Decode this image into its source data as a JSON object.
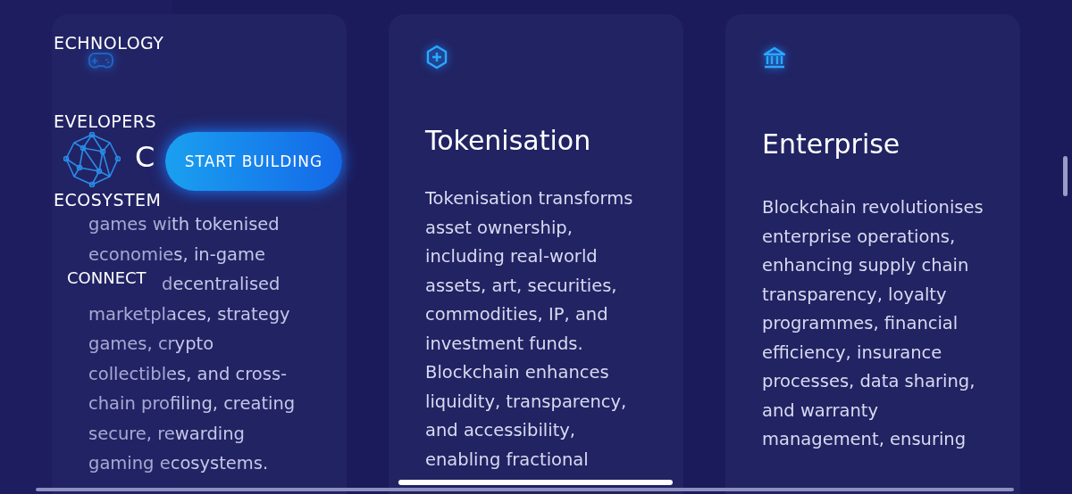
{
  "cards": [
    {
      "lines": [
        {
          "text": "games with tokenised",
          "kind": "full"
        },
        {
          "text": "economies, in-game",
          "kind": "full"
        },
        {
          "text": "decentralised",
          "kind": "cut"
        },
        {
          "text": "marketplaces, strategy",
          "kind": "full"
        },
        {
          "text": "games, crypto",
          "kind": "full"
        },
        {
          "text": "collectibles, and cross-",
          "kind": "full"
        },
        {
          "text": "chain profiling, creating",
          "kind": "full"
        },
        {
          "text": "secure, rewarding",
          "kind": "full"
        },
        {
          "text": "gaming ecosystems.",
          "kind": "full"
        }
      ]
    },
    {
      "title": "Tokenisation",
      "body": "Tokenisation transforms asset ownership, including real-world assets, art, securities, commodities, IP, and investment funds. Blockchain enhances liquidity, transparency, and accessibility, enabling fractional"
    },
    {
      "title": "Enterprise",
      "body": "Blockchain revolutionises enterprise operations, enhancing supply chain transparency, loyalty programmes, financial efficiency, insurance processes, data sharing, and warranty management, ensuring"
    }
  ],
  "menu": {
    "logo_text": "C",
    "items": [
      "ECHNOLOGY",
      "EVELOPERS",
      "ECOSYSTEM",
      "CONNECT"
    ],
    "button": "START BUILDING"
  }
}
